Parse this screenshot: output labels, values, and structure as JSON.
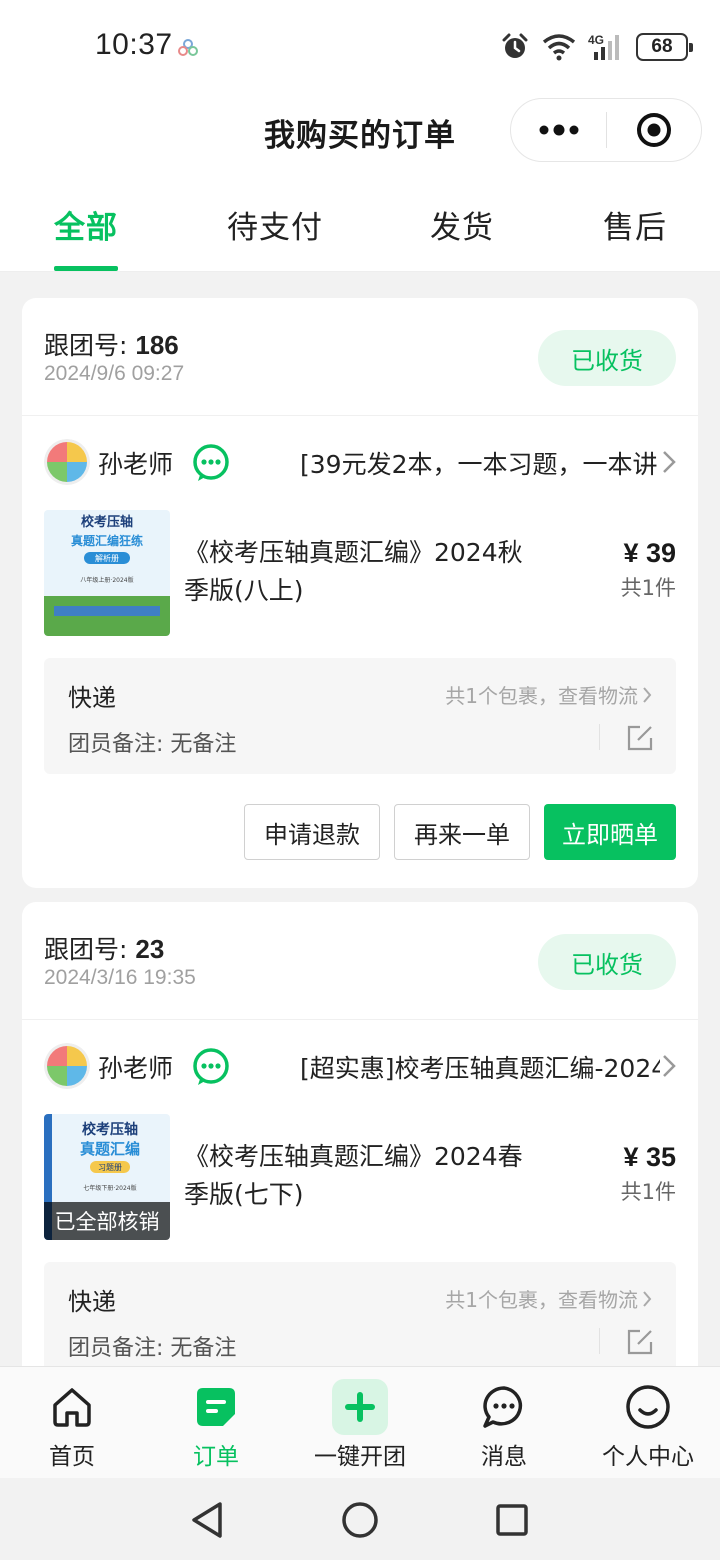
{
  "status_bar": {
    "time": "10:37",
    "battery": "68",
    "network": "4G"
  },
  "header": {
    "title": "我购买的订单"
  },
  "tabs": [
    {
      "label": "全部",
      "active": true
    },
    {
      "label": "待支付",
      "active": false
    },
    {
      "label": "发货",
      "active": false
    },
    {
      "label": "售后",
      "active": false
    }
  ],
  "orders": [
    {
      "group_label": "跟团号: ",
      "group_no": "186",
      "time": "2024/9/6 09:27",
      "status": "已收货",
      "seller": "孙老师",
      "group_title": "[39元发2本，一本习题，一本讲",
      "product_name": "《校考压轴真题汇编》2024秋季版(八上)",
      "price": "¥ 39",
      "qty": "共1件",
      "thumb": {
        "line1": "校考压轴",
        "line2": "真题汇编狂练",
        "tag": "解析册",
        "grade": "八年级上册·2024版"
      },
      "shipping": {
        "label": "快递",
        "link": "共1个包裹，查看物流"
      },
      "remark": "团员备注: 无备注",
      "actions": {
        "refund": "申请退款",
        "reorder": "再来一单",
        "share": "立即晒单"
      }
    },
    {
      "group_label": "跟团号: ",
      "group_no": "23",
      "time": "2024/3/16 19:35",
      "status": "已收货",
      "seller": "孙老师",
      "group_title": "[超实惠]校考压轴真题汇编-2024",
      "product_name": "《校考压轴真题汇编》2024春季版(七下)",
      "price": "¥ 35",
      "qty": "共1件",
      "thumb": {
        "line1": "校考压轴",
        "line2": "真题汇编",
        "tag": "习题册",
        "grade": "七年级下册·2024版",
        "overlay": "已全部核销"
      },
      "shipping": {
        "label": "快递",
        "link": "共1个包裹，查看物流"
      },
      "remark": "团员备注: 无备注"
    }
  ],
  "bottom_nav": [
    {
      "label": "首页",
      "icon": "home-icon",
      "active": false
    },
    {
      "label": "订单",
      "icon": "order-icon",
      "active": true
    },
    {
      "label": "一键开团",
      "icon": "plus-icon",
      "active": false
    },
    {
      "label": "消息",
      "icon": "message-icon",
      "active": false
    },
    {
      "label": "个人中心",
      "icon": "profile-icon",
      "active": false
    }
  ],
  "colors": {
    "accent": "#07c160",
    "badge_bg": "#e7f8ee",
    "page_bg": "#f2f2f2"
  }
}
